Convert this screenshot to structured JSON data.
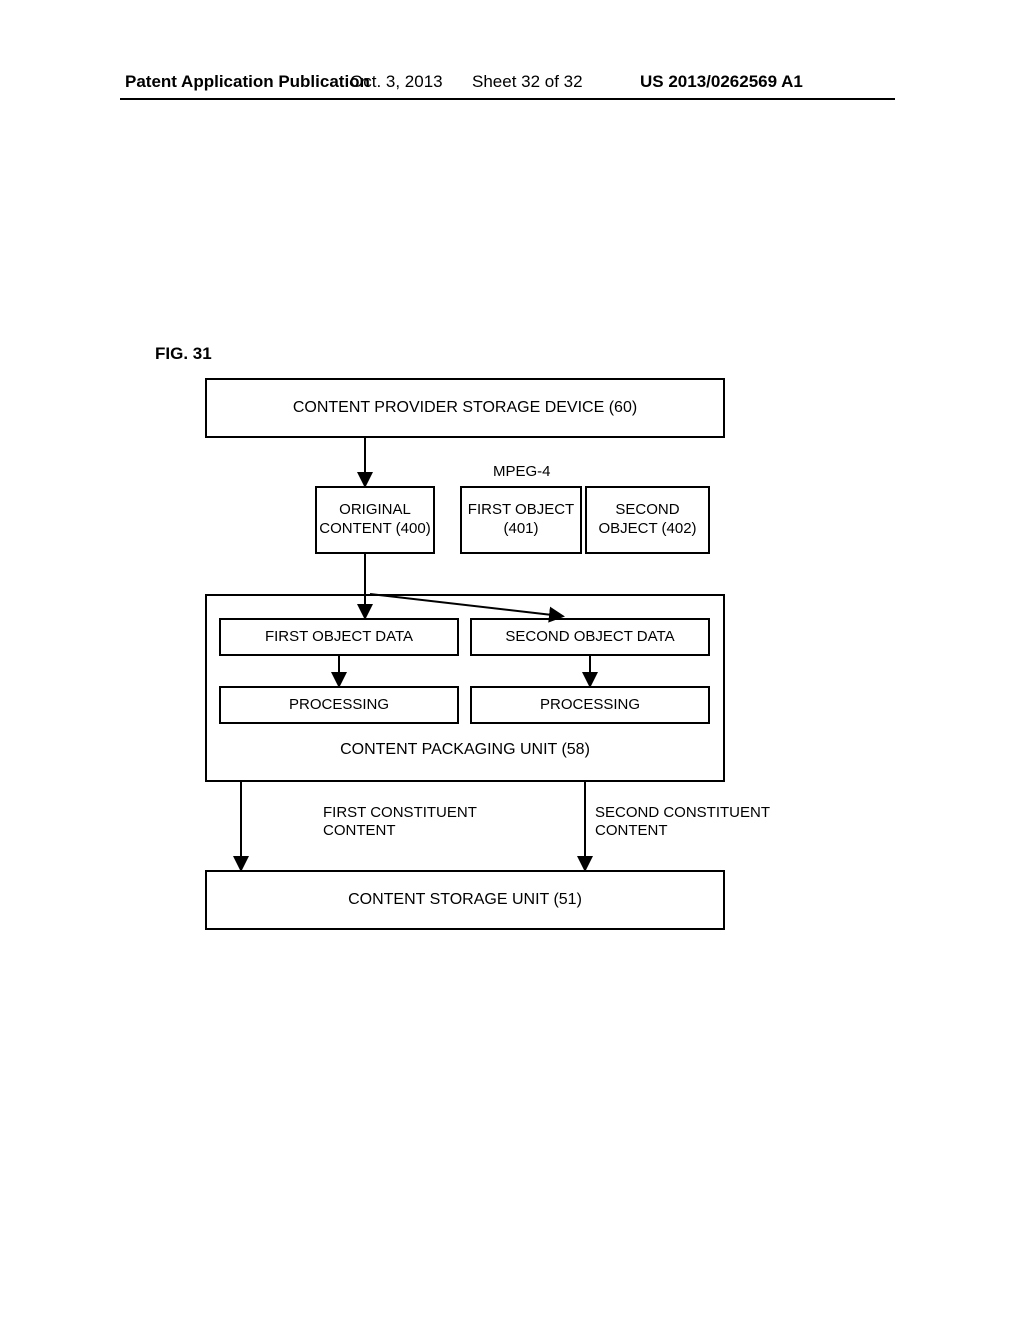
{
  "header": {
    "source": "Patent Application Publication",
    "date": "Oct. 3, 2013",
    "sheet": "Sheet 32 of 32",
    "pubnum": "US 2013/0262569 A1"
  },
  "figure_label": "FIG. 31",
  "diagram": {
    "provider": "CONTENT PROVIDER STORAGE DEVICE (60)",
    "mpeg": "MPEG-4",
    "original": "ORIGINAL CONTENT (400)",
    "obj1": "FIRST OBJECT (401)",
    "obj2": "SECOND OBJECT (402)",
    "od1": "FIRST OBJECT DATA",
    "od2": "SECOND OBJECT DATA",
    "proc1": "PROCESSING",
    "proc2": "PROCESSING",
    "pkg": "CONTENT PACKAGING UNIT (58)",
    "cc1": "FIRST CONSTITUENT CONTENT",
    "cc2": "SECOND CONSTITUENT CONTENT",
    "store": "CONTENT STORAGE UNIT (51)"
  }
}
